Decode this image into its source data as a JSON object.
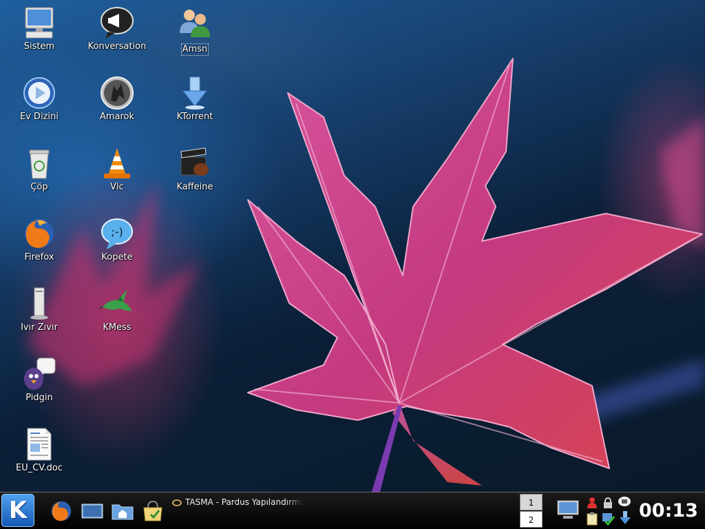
{
  "desktop": {
    "icons": [
      {
        "label": "Sistem",
        "icon": "computer-icon"
      },
      {
        "label": "Konversation",
        "icon": "konversation-icon"
      },
      {
        "label": "Amsn",
        "icon": "amsn-icon"
      },
      {
        "label": "Ev Dizini",
        "icon": "home-folder-icon"
      },
      {
        "label": "Amarok",
        "icon": "amarok-icon"
      },
      {
        "label": "KTorrent",
        "icon": "ktorrent-icon"
      },
      {
        "label": "Çöp",
        "icon": "trash-icon"
      },
      {
        "label": "Vlc",
        "icon": "vlc-icon"
      },
      {
        "label": "Kaffeine",
        "icon": "kaffeine-icon"
      },
      {
        "label": "Firefox",
        "icon": "firefox-icon"
      },
      {
        "label": "Kopete",
        "icon": "kopete-icon"
      },
      {
        "label": "Ivır Zıvır",
        "icon": "misc-drive-icon"
      },
      {
        "label": "KMess",
        "icon": "kmess-icon"
      },
      {
        "label": "Pidgin",
        "icon": "pidgin-icon"
      },
      {
        "label": "EU_CV.doc",
        "icon": "document-icon"
      }
    ]
  },
  "taskbar": {
    "kmenu_label": "K",
    "quicklaunch": [
      "firefox-icon",
      "desktop-icon",
      "file-manager-icon",
      "package-icon"
    ],
    "task_title": "TASMA - Pardus Yapılandırma",
    "pager": [
      "1",
      "2"
    ],
    "clock": "00:13"
  },
  "colors": {
    "taskbar_bg": "#000000",
    "kmenu_blue": "#2a78d4",
    "leaf": "#c8307a"
  }
}
